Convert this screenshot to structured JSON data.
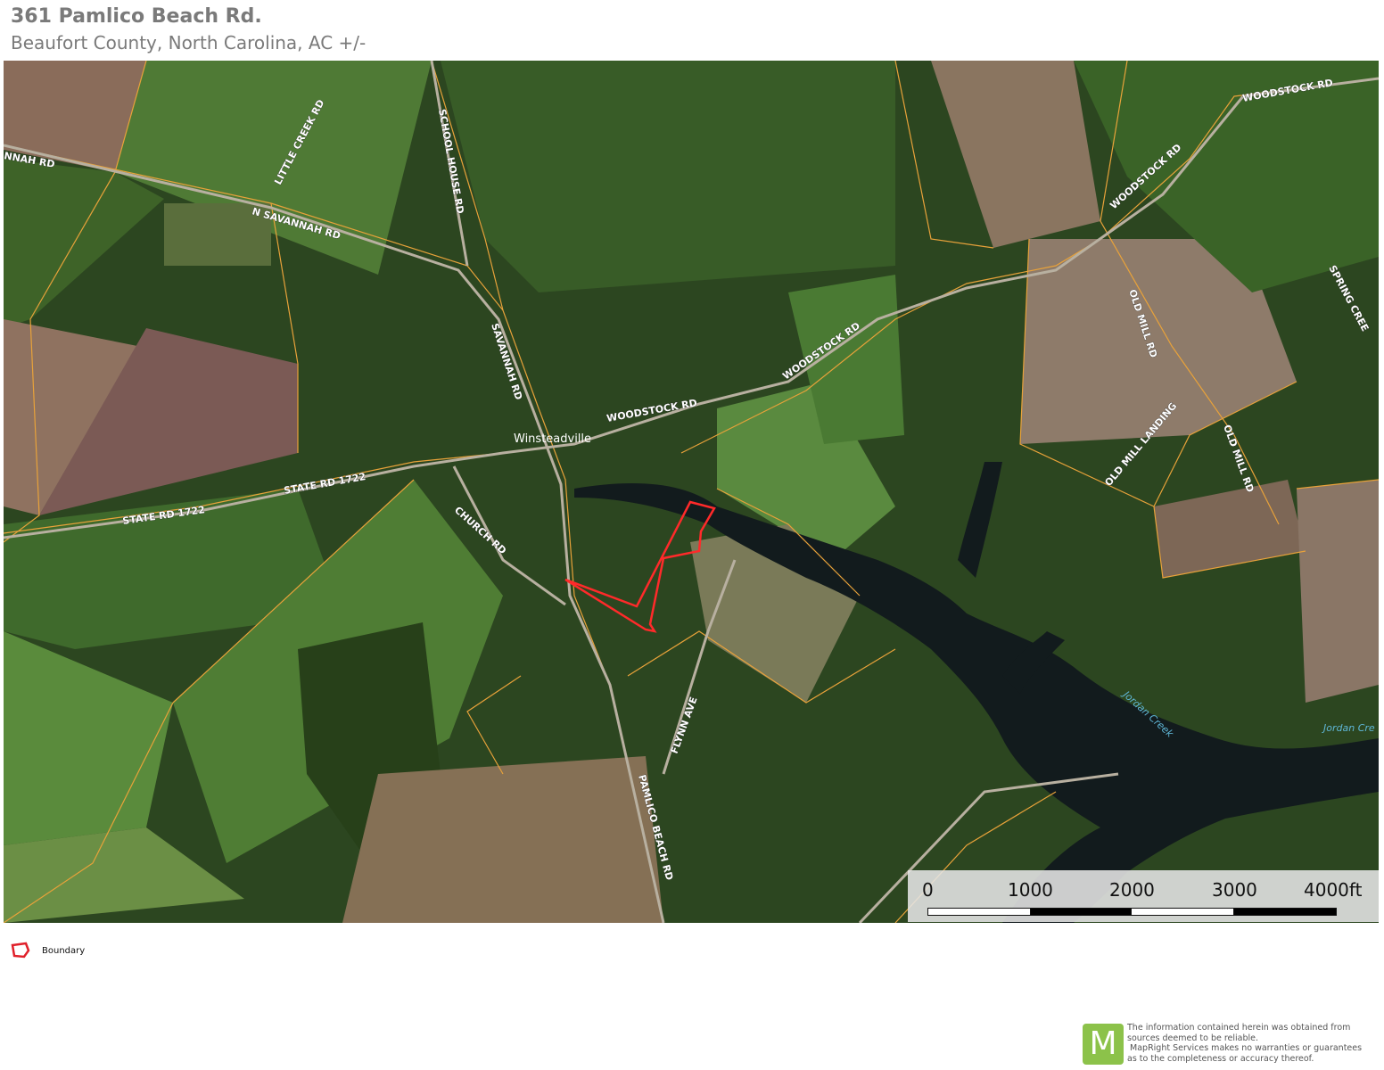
{
  "header": {
    "title": "361 Pamlico Beach Rd.",
    "subtitle": "Beaufort County, North Carolina,  AC +/-"
  },
  "map": {
    "place_label": "Winsteadville",
    "water_labels": [
      "Jordan Creek",
      "Jordan Cre"
    ],
    "road_labels": {
      "n_savannah_partial": "NNAH RD",
      "little_creek": "LITTLE CREEK RD",
      "school_house": "SCHOOL HOUSE RD",
      "n_savannah": "N SAVANNAH RD",
      "savannah": "SAVANNAH RD",
      "woodstock_1": "WOODSTOCK RD",
      "woodstock_2": "WOODSTOCK RD",
      "woodstock_3": "WOODSTOCK RD",
      "woodstock_4": "WOODSTOCK RD",
      "state_rd_1": "STATE RD 1722",
      "state_rd_2": "STATE RD 1722",
      "church": "CHURCH RD",
      "pamlico_beach": "PAMLICO BEACH RD",
      "flynn": "FLYNN AVE",
      "old_mill_1": "OLD MILL RD",
      "old_mill_2": "OLD MILL RD",
      "old_mill_landing": "OLD MILL LANDING",
      "spring_creek": "SPRING CREE"
    },
    "colors": {
      "boundary": "#ff2a2a",
      "parcel_lines": "#e8a23a",
      "water": "#111a1c"
    }
  },
  "scale_bar": {
    "ticks": [
      "0",
      "1000",
      "2000",
      "3000",
      "4000ft"
    ]
  },
  "legend": {
    "items": [
      {
        "label": "Boundary",
        "icon": "boundary-polygon-icon"
      }
    ]
  },
  "footer": {
    "logo_letter": "M",
    "disclaimer_lines": [
      "The information contained herein was obtained from",
      "sources deemed to be reliable.",
      " MapRight Services makes no warranties or guarantees",
      "as to the completeness or accuracy thereof."
    ]
  }
}
